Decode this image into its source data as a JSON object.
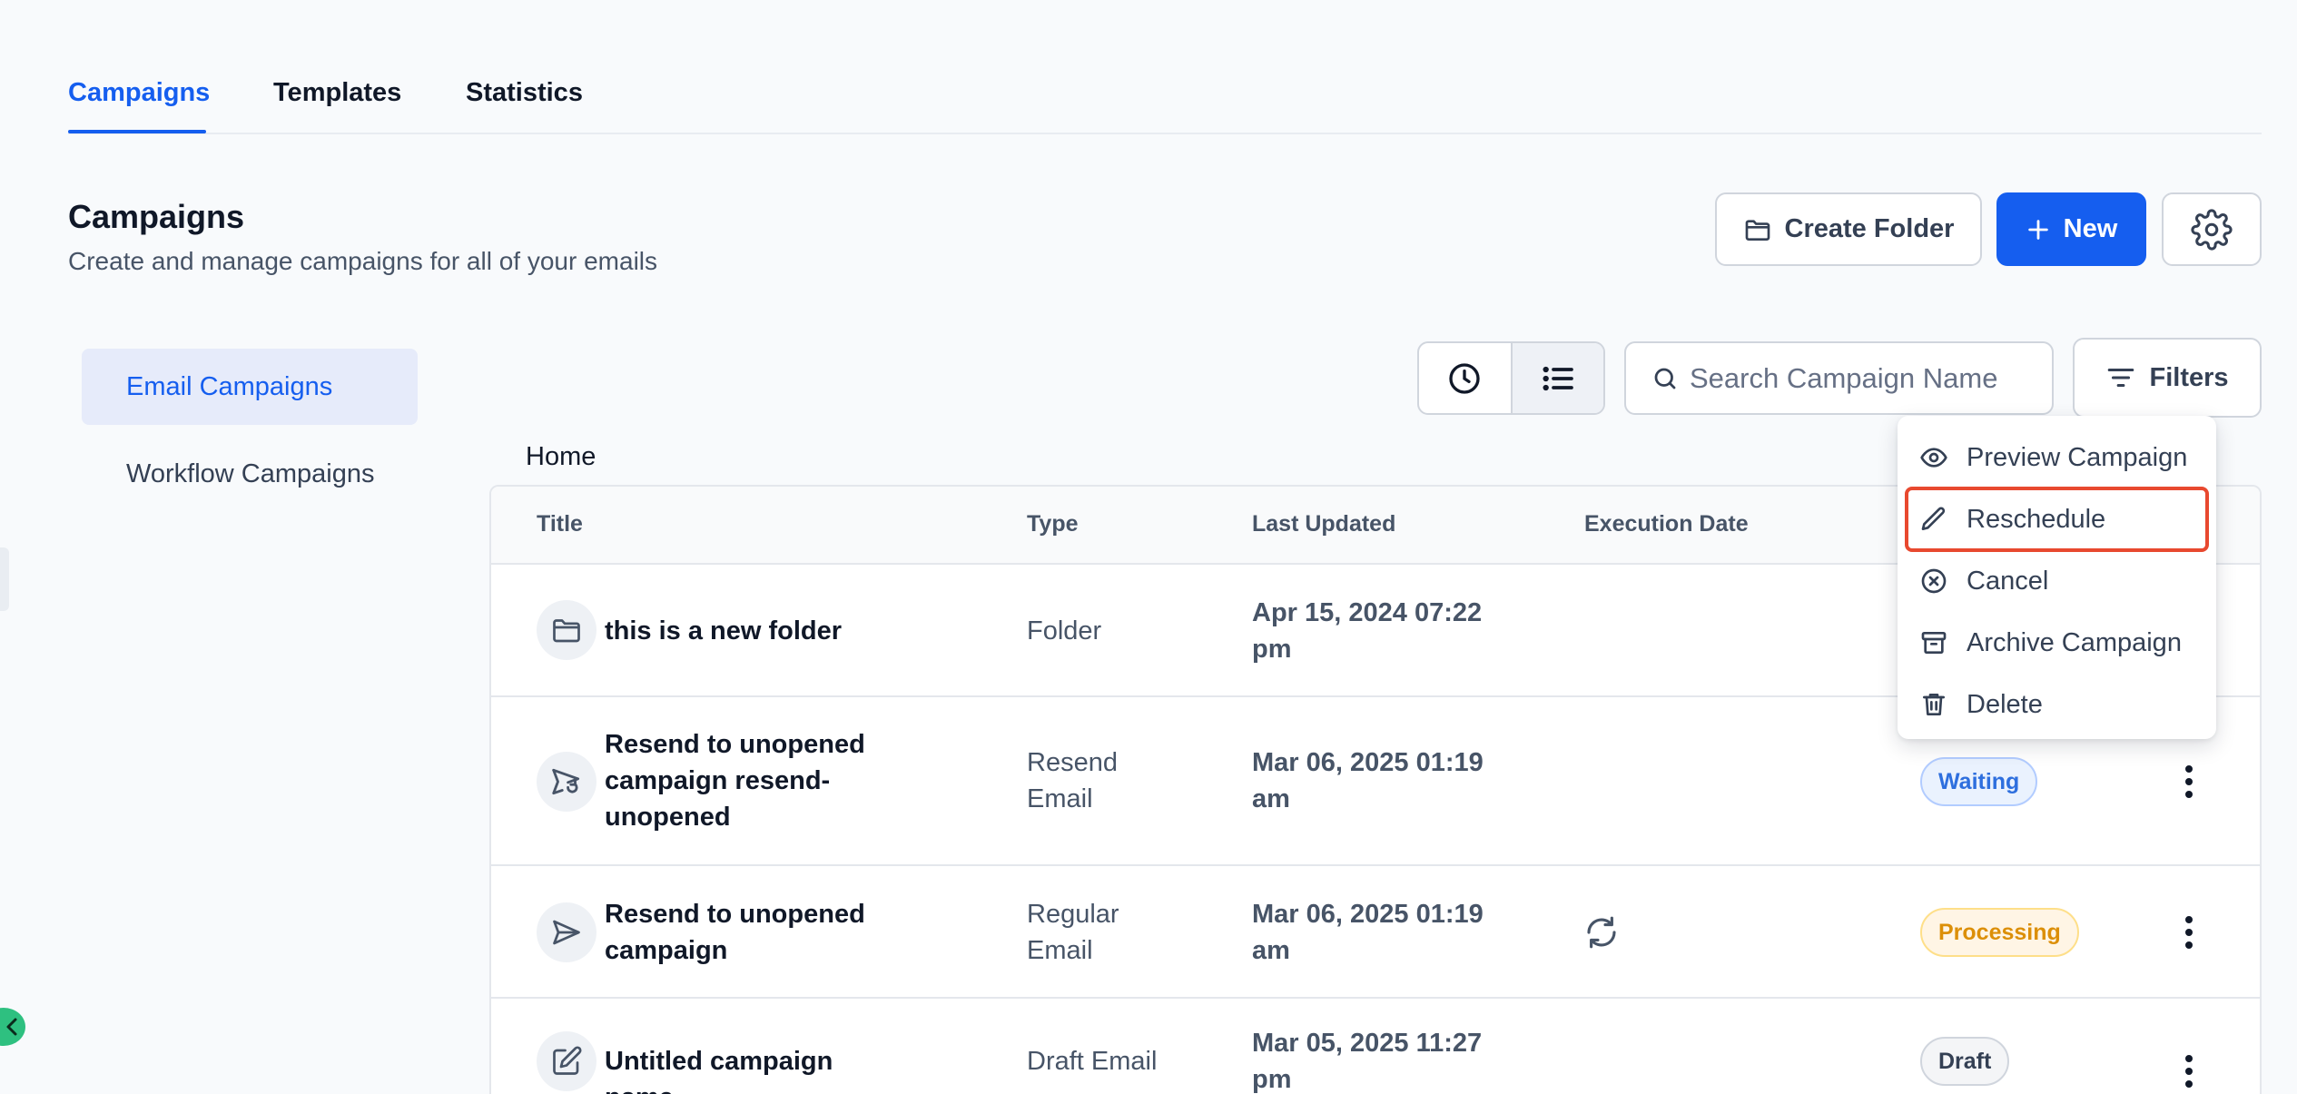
{
  "tabs": [
    {
      "label": "Campaigns",
      "active": true
    },
    {
      "label": "Templates",
      "active": false
    },
    {
      "label": "Statistics",
      "active": false
    }
  ],
  "header": {
    "title": "Campaigns",
    "subtitle": "Create and manage campaigns for all of your emails",
    "create_folder_label": "Create Folder",
    "new_label": "New"
  },
  "sidebar": {
    "items": [
      {
        "label": "Email Campaigns",
        "active": true
      },
      {
        "label": "Workflow Campaigns",
        "active": false
      }
    ]
  },
  "toolbar": {
    "search_placeholder": "Search Campaign Name",
    "filters_label": "Filters"
  },
  "breadcrumb": "Home",
  "table": {
    "columns": [
      "Title",
      "Type",
      "Last Updated",
      "Execution Date"
    ],
    "rows": [
      {
        "icon": "folder-icon",
        "title": "this is a new folder",
        "type": "Folder",
        "last_updated": "Apr 15, 2024 07:22 pm",
        "status": ""
      },
      {
        "icon": "resend-icon",
        "title": "Resend to unopened campaign resend-unopened",
        "type": "Resend Email",
        "last_updated": "Mar 06, 2025 01:19 am",
        "status": "Waiting"
      },
      {
        "icon": "send-icon",
        "title": "Resend to unopened campaign",
        "type": "Regular Email",
        "last_updated": "Mar 06, 2025 01:19 am",
        "status": "Processing"
      },
      {
        "icon": "edit-icon",
        "title": "Untitled campaign name",
        "type": "Draft Email",
        "last_updated": "Mar 05, 2025 11:27 pm",
        "status": "Draft"
      }
    ]
  },
  "menu": {
    "items": [
      {
        "label": "Preview Campaign",
        "icon": "eye-icon"
      },
      {
        "label": "Reschedule",
        "icon": "pencil-icon",
        "highlighted": true
      },
      {
        "label": "Cancel",
        "icon": "x-circle-icon"
      },
      {
        "label": "Archive Campaign",
        "icon": "archive-icon"
      },
      {
        "label": "Delete",
        "icon": "trash-icon"
      }
    ]
  },
  "colors": {
    "accent": "#155eef",
    "highlight_border": "#e8492f",
    "waiting": "#2e6fde",
    "processing": "#dc8f08"
  }
}
